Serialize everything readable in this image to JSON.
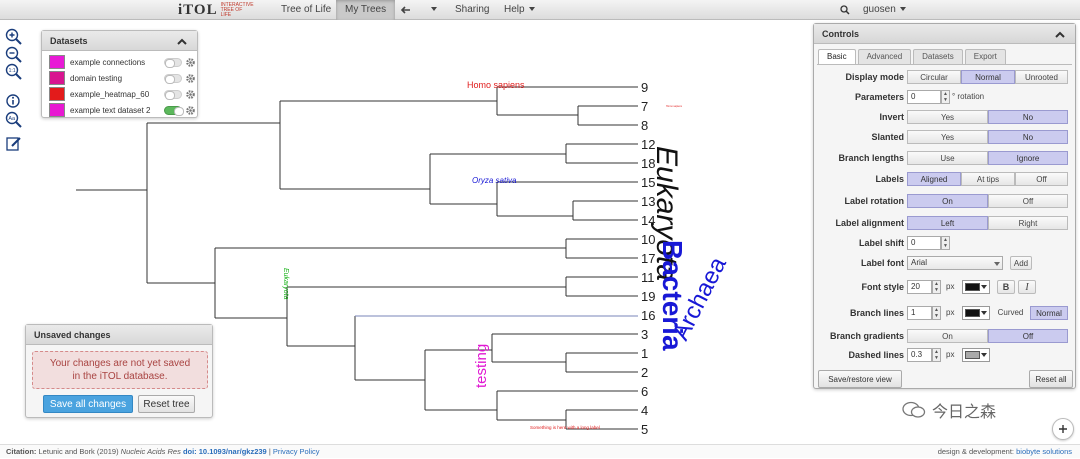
{
  "topbar": {
    "logo": "iTOL",
    "logo_sub": "INTERACTIVE TREE OF LIFE",
    "nav": [
      "Tree of Life",
      "My Trees",
      "Sharing",
      "Help"
    ],
    "user": "guosen"
  },
  "datasets": {
    "title": "Datasets",
    "items": [
      {
        "label": "example connections",
        "color": "#e81ad6",
        "enabled": false
      },
      {
        "label": "domain testing",
        "color": "#d81590",
        "enabled": false
      },
      {
        "label": "example_heatmap_60",
        "color": "#e31b1b",
        "enabled": false
      },
      {
        "label": "example text dataset 2",
        "color": "#e818d2",
        "enabled": true
      }
    ]
  },
  "unsaved": {
    "title": "Unsaved changes",
    "message_line1": "Your changes are not yet saved",
    "message_line2": "in the iTOL database.",
    "save_label": "Save all changes",
    "reset_label": "Reset tree"
  },
  "tree": {
    "leaves": [
      "9",
      "7",
      "8",
      "12",
      "18",
      "15",
      "13",
      "14",
      "10",
      "17",
      "11",
      "19",
      "16",
      "3",
      "1",
      "2",
      "6",
      "4",
      "5"
    ],
    "annotations": {
      "homo": "Homo sapiens",
      "oryza": "Oryza sativa",
      "eukaryota_small": "Eukaryota",
      "testing": "testing",
      "eukaryota_big": "Eukaryota",
      "bacteria": "Bacteria",
      "archaea": "Archaea",
      "tiny_label": "Homo sapiens",
      "something": "Something is here with a long label"
    }
  },
  "controls": {
    "title": "Controls",
    "tabs": [
      "Basic",
      "Advanced",
      "Datasets",
      "Export"
    ],
    "display_mode": {
      "label": "Display mode",
      "options": [
        "Circular",
        "Normal",
        "Unrooted"
      ],
      "selected": "Normal"
    },
    "parameters": {
      "label": "Parameters",
      "value": "0",
      "unit": "° rotation"
    },
    "invert": {
      "label": "Invert",
      "options": [
        "Yes",
        "No"
      ],
      "selected": "No"
    },
    "slanted": {
      "label": "Slanted",
      "options": [
        "Yes",
        "No"
      ],
      "selected": "No"
    },
    "branch_lengths": {
      "label": "Branch lengths",
      "options": [
        "Use",
        "Ignore"
      ],
      "selected": "Ignore"
    },
    "labels": {
      "label": "Labels",
      "options": [
        "Aligned",
        "At tips",
        "Off"
      ],
      "selected": "Aligned"
    },
    "label_rotation": {
      "label": "Label rotation",
      "options": [
        "On",
        "Off"
      ],
      "selected": "On"
    },
    "label_alignment": {
      "label": "Label alignment",
      "options": [
        "Left",
        "Right"
      ],
      "selected": "Left"
    },
    "label_shift": {
      "label": "Label shift",
      "value": "0"
    },
    "label_font": {
      "label": "Label font",
      "value": "Arial",
      "add": "Add"
    },
    "font_style": {
      "label": "Font style",
      "size": "20",
      "unit": "px",
      "bold": "B",
      "italic": "I",
      "color": "#111111"
    },
    "branch_lines": {
      "label": "Branch lines",
      "size": "1",
      "unit": "px",
      "color": "#111111",
      "options": [
        "Curved",
        "Normal"
      ],
      "selected": "Normal"
    },
    "branch_gradients": {
      "label": "Branch gradients",
      "options": [
        "On",
        "Off"
      ],
      "selected": "Off"
    },
    "dashed_lines": {
      "label": "Dashed lines",
      "value": "0.3",
      "unit": "px",
      "color": "#aaaaaa"
    },
    "save_restore": "Save/restore view",
    "reset_all": "Reset all"
  },
  "footer": {
    "citation_label": "Citation:",
    "citation_text": "Letunic and Bork (2019)",
    "journal": "Nucleic Acids Res",
    "doi": "doi: 10.1093/nar/gkz239",
    "privacy": "Privacy Policy",
    "design": "design & development:",
    "company": "biobyte solutions"
  },
  "watermark": "今日之森"
}
